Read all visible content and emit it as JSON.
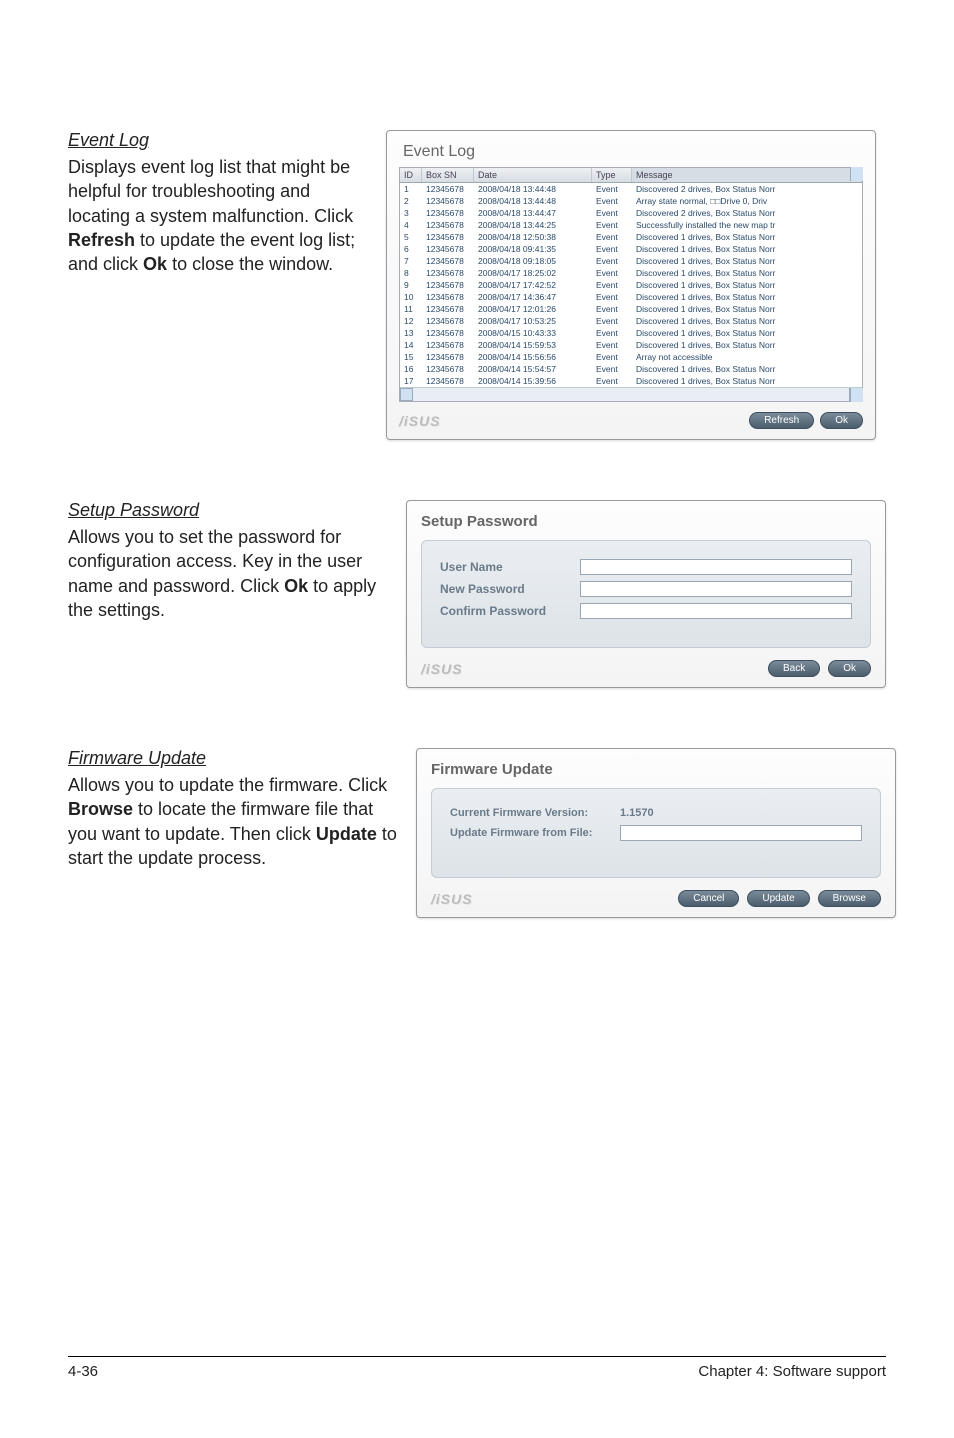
{
  "sections": {
    "eventlog": {
      "heading": "Event Log",
      "body_pre": "Displays event log list that might be helpful for troubleshooting and locating a system malfunction. Click ",
      "body_b1": "Refresh",
      "body_mid": " to update the event log list; and click ",
      "body_b2": "Ok",
      "body_post": " to close the window."
    },
    "setuppw": {
      "heading": "Setup Password",
      "body_pre": "Allows you to set the password for configuration access. Key in the user name and password. Click ",
      "body_b1": "Ok",
      "body_post": " to apply the settings."
    },
    "fwupd": {
      "heading": "Firmware Update",
      "body_pre": "Allows you to update the firmware. Click ",
      "body_b1": "Browse",
      "body_mid": " to locate the firmware file that you want to update. Then click ",
      "body_b2": "Update",
      "body_post": " to start the update process."
    }
  },
  "eventlog_panel": {
    "title": "Event Log",
    "headers": {
      "id": "ID",
      "sn": "Box SN",
      "date": "Date",
      "type": "Type",
      "msg": "Message"
    },
    "rows": [
      {
        "id": "1",
        "sn": "12345678",
        "date": "2008/04/18 13:44:48",
        "type": "Event",
        "msg": "Discovered 2 drives, Box Status Norr"
      },
      {
        "id": "2",
        "sn": "12345678",
        "date": "2008/04/18 13:44:48",
        "type": "Event",
        "msg": "Array state normal, □□Drive 0, Driv"
      },
      {
        "id": "3",
        "sn": "12345678",
        "date": "2008/04/18 13:44:47",
        "type": "Event",
        "msg": "Discovered 2 drives, Box Status Norr"
      },
      {
        "id": "4",
        "sn": "12345678",
        "date": "2008/04/18 13:44:25",
        "type": "Event",
        "msg": "Successfully installed the new map tr"
      },
      {
        "id": "5",
        "sn": "12345678",
        "date": "2008/04/18 12:50:38",
        "type": "Event",
        "msg": "Discovered 1 drives, Box Status Norr"
      },
      {
        "id": "6",
        "sn": "12345678",
        "date": "2008/04/18 09:41:35",
        "type": "Event",
        "msg": "Discovered 1 drives, Box Status Norr"
      },
      {
        "id": "7",
        "sn": "12345678",
        "date": "2008/04/18 09:18:05",
        "type": "Event",
        "msg": "Discovered 1 drives, Box Status Norr"
      },
      {
        "id": "8",
        "sn": "12345678",
        "date": "2008/04/17 18:25:02",
        "type": "Event",
        "msg": "Discovered 1 drives, Box Status Norr"
      },
      {
        "id": "9",
        "sn": "12345678",
        "date": "2008/04/17 17:42:52",
        "type": "Event",
        "msg": "Discovered 1 drives, Box Status Norr"
      },
      {
        "id": "10",
        "sn": "12345678",
        "date": "2008/04/17 14:36:47",
        "type": "Event",
        "msg": "Discovered 1 drives, Box Status Norr"
      },
      {
        "id": "11",
        "sn": "12345678",
        "date": "2008/04/17 12:01:26",
        "type": "Event",
        "msg": "Discovered 1 drives, Box Status Norr"
      },
      {
        "id": "12",
        "sn": "12345678",
        "date": "2008/04/17 10:53:25",
        "type": "Event",
        "msg": "Discovered 1 drives, Box Status Norr"
      },
      {
        "id": "13",
        "sn": "12345678",
        "date": "2008/04/15 10:43:33",
        "type": "Event",
        "msg": "Discovered 1 drives, Box Status Norr"
      },
      {
        "id": "14",
        "sn": "12345678",
        "date": "2008/04/14 15:59:53",
        "type": "Event",
        "msg": "Discovered 1 drives, Box Status Norr"
      },
      {
        "id": "15",
        "sn": "12345678",
        "date": "2008/04/14 15:56:56",
        "type": "Event",
        "msg": "Array not accessible"
      },
      {
        "id": "16",
        "sn": "12345678",
        "date": "2008/04/14 15:54:57",
        "type": "Event",
        "msg": "Discovered 1 drives, Box Status Norr"
      },
      {
        "id": "17",
        "sn": "12345678",
        "date": "2008/04/14 15:39:56",
        "type": "Event",
        "msg": "Discovered 1 drives, Box Status Norr"
      }
    ],
    "buttons": {
      "refresh": "Refresh",
      "ok": "Ok"
    }
  },
  "setuppw_panel": {
    "title": "Setup Password",
    "labels": {
      "user": "User Name",
      "newpw": "New Password",
      "confirm": "Confirm Password"
    },
    "buttons": {
      "back": "Back",
      "ok": "Ok"
    }
  },
  "fwupd_panel": {
    "title": "Firmware Update",
    "labels": {
      "current": "Current Firmware Version:",
      "file": "Update Firmware from File:"
    },
    "current_value": "1.1570",
    "buttons": {
      "cancel": "Cancel",
      "update": "Update",
      "browse": "Browse"
    }
  },
  "footer": {
    "left": "4-36",
    "right": "Chapter 4: Software support"
  },
  "logo": "/iSUS"
}
